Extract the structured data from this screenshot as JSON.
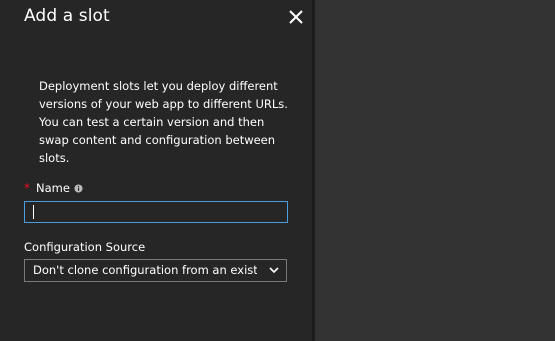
{
  "panel": {
    "title": "Add a slot",
    "close_icon": "close-icon",
    "description": "Deployment slots let you deploy different versions of your web app to different URLs. You can test a certain version and then swap content and configuration between slots.",
    "name_field": {
      "required_marker": "*",
      "label": "Name",
      "info_icon": "info-icon",
      "value": ""
    },
    "config_source": {
      "label": "Configuration Source",
      "selected": "Don't clone configuration from an existi...",
      "chevron_icon": "chevron-down-icon"
    }
  },
  "colors": {
    "panel_bg": "#262626",
    "page_bg": "#333333",
    "input_focus_border": "#4a9ee0",
    "required_red": "#e81123"
  }
}
